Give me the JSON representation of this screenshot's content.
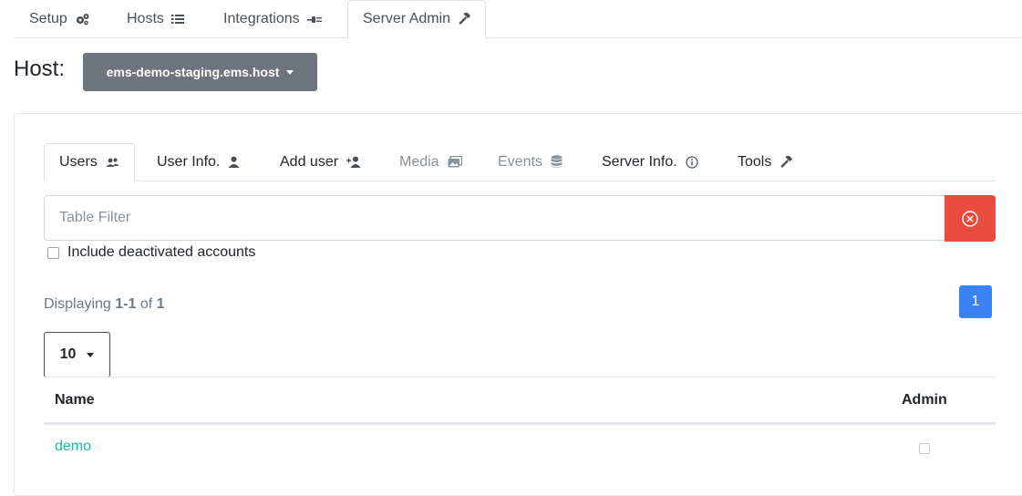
{
  "top_tabs": [
    {
      "label": "Setup",
      "icon": "cogs-icon"
    },
    {
      "label": "Hosts",
      "icon": "list-icon"
    },
    {
      "label": "Integrations",
      "icon": "plug-icon"
    },
    {
      "label": "Server Admin",
      "icon": "hammer-icon",
      "active": true
    }
  ],
  "host": {
    "label": "Host:",
    "selected": "ems-demo-staging.ems.host"
  },
  "inner_tabs": [
    {
      "label": "Users",
      "icon": "users-icon",
      "active": true
    },
    {
      "label": "User Info.",
      "icon": "user-icon"
    },
    {
      "label": "Add user",
      "icon": "user-plus-icon"
    },
    {
      "label": "Media",
      "icon": "images-icon",
      "disabled": true
    },
    {
      "label": "Events",
      "icon": "database-icon",
      "disabled": true
    },
    {
      "label": "Server Info.",
      "icon": "info-circle-icon"
    },
    {
      "label": "Tools",
      "icon": "hammer-icon"
    }
  ],
  "filter": {
    "placeholder": "Table Filter",
    "value": ""
  },
  "include_deactivated": {
    "label": "Include deactivated accounts",
    "checked": false
  },
  "pagination": {
    "prefix": "Displaying ",
    "range": "1-1",
    "of": " of ",
    "total": "1",
    "current_page": "1"
  },
  "page_size": "10",
  "table": {
    "columns": [
      "Name",
      "Admin"
    ],
    "rows": [
      {
        "name": "demo",
        "admin": false
      }
    ]
  },
  "colors": {
    "accent": "#3b82f6",
    "danger": "#e74c3c",
    "link": "#18bc9c",
    "secondary": "#6c757d"
  }
}
